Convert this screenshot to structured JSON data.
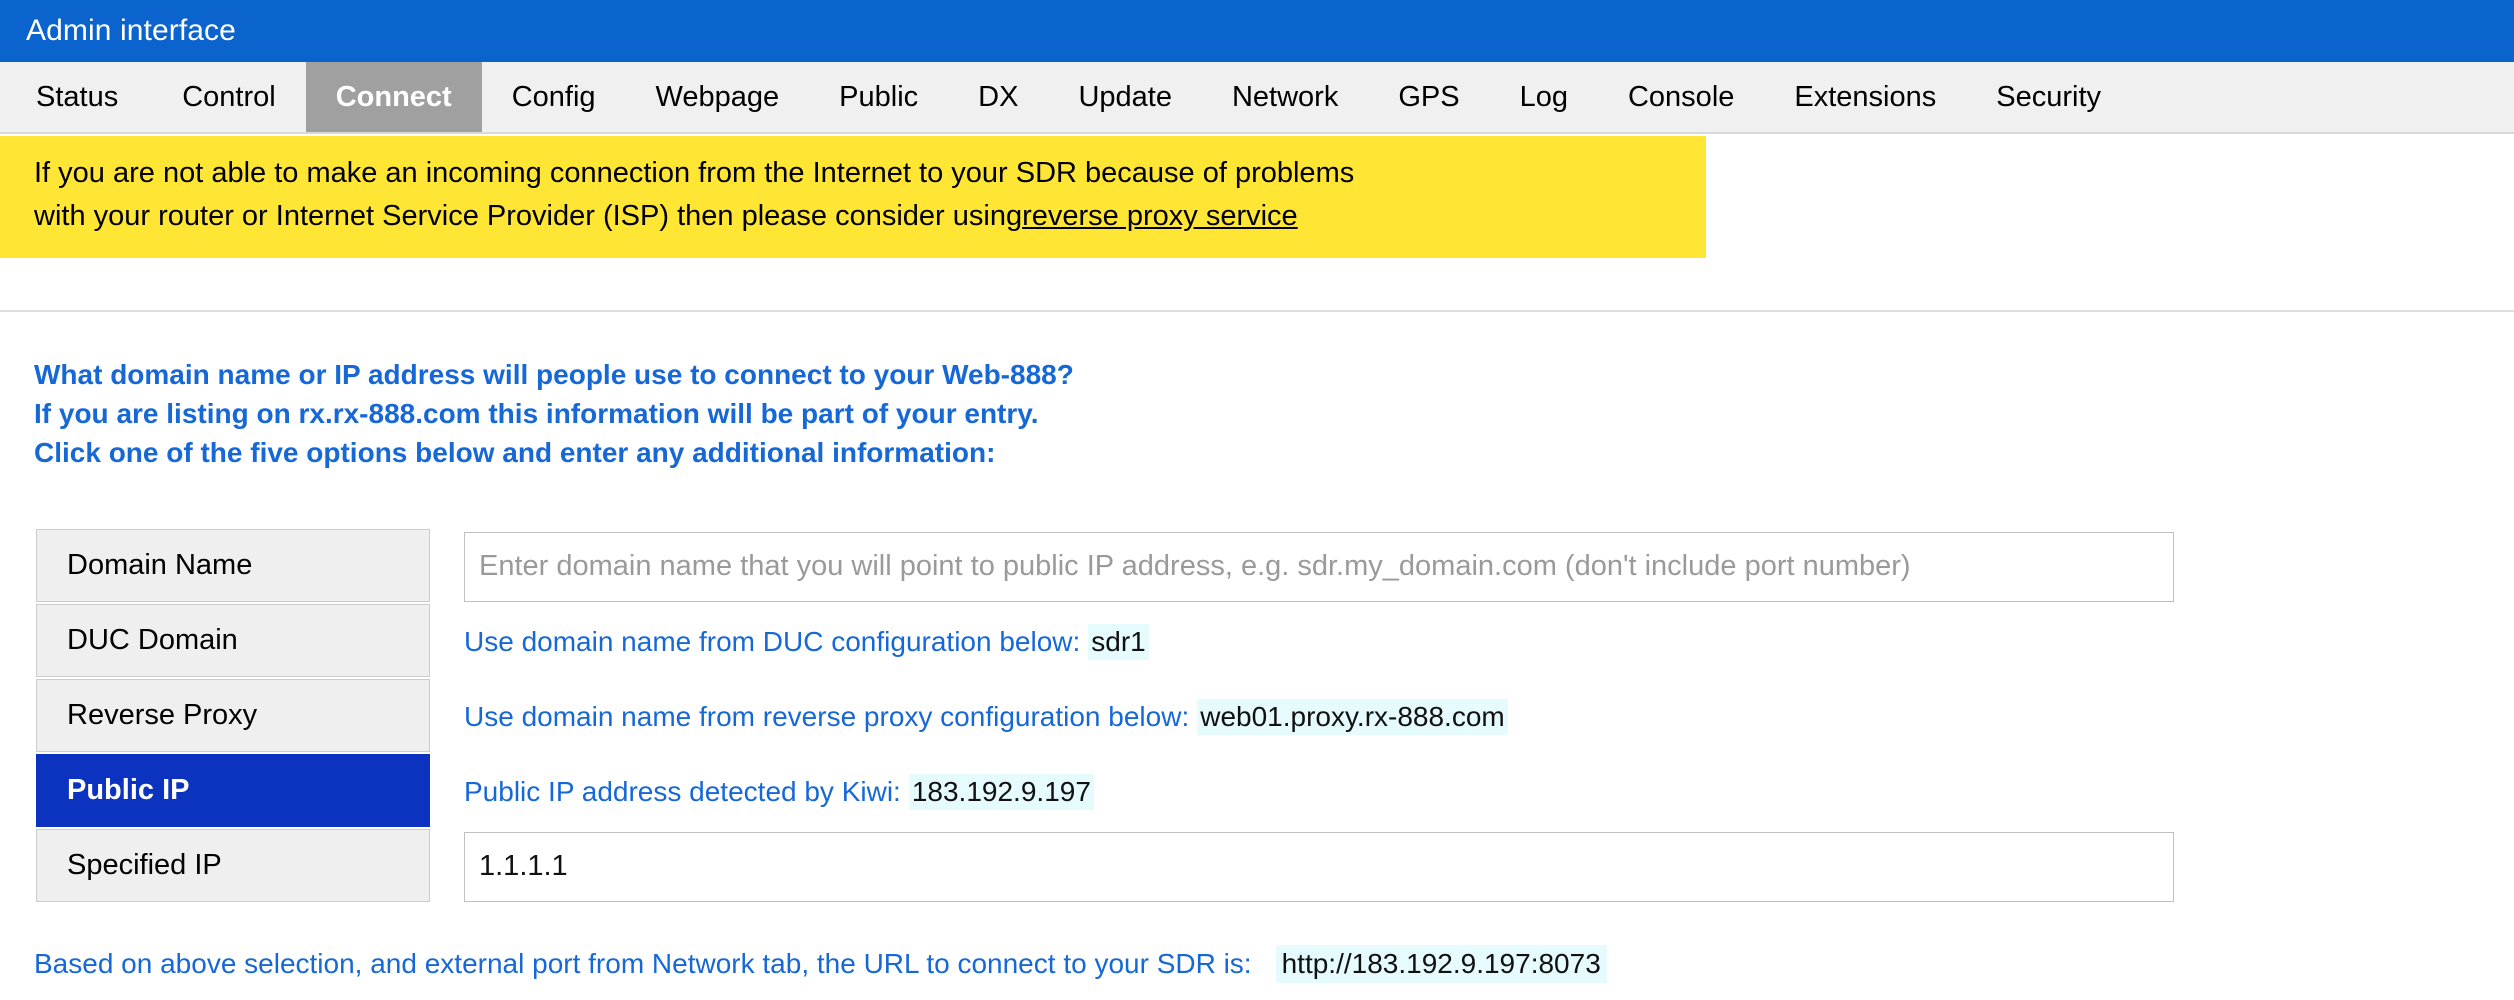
{
  "titlebar": {
    "title": "Admin interface",
    "background_color": "#0b63ce"
  },
  "tabs": {
    "active": "Connect",
    "active_background_color": "#a0a0a0",
    "items": [
      {
        "label": "Status"
      },
      {
        "label": "Control"
      },
      {
        "label": "Connect"
      },
      {
        "label": "Config"
      },
      {
        "label": "Webpage"
      },
      {
        "label": "Public"
      },
      {
        "label": "DX"
      },
      {
        "label": "Update"
      },
      {
        "label": "Network"
      },
      {
        "label": "GPS"
      },
      {
        "label": "Log"
      },
      {
        "label": "Console"
      },
      {
        "label": "Extensions"
      },
      {
        "label": "Security"
      }
    ]
  },
  "notice": {
    "background_color": "#ffe534",
    "line1": "If you are not able to make an incoming connection from the Internet to your SDR because of problems",
    "line2_prefix": "with your router or Internet Service Provider (ISP) then please consider using",
    "link_text": "reverse proxy service"
  },
  "headings": {
    "color": "#1668d6",
    "line1": "What domain name or IP address will people use to connect to your Web-888?",
    "line2": "If you are listing on rx.rx-888.com this information will be part of your entry.",
    "line3": "Click one of the five options below and enter any additional information:"
  },
  "chooser": {
    "selected_background_color": "#0b33bf",
    "items": [
      {
        "label": "Domain Name",
        "selected": false
      },
      {
        "label": "DUC Domain",
        "selected": false
      },
      {
        "label": "Reverse Proxy",
        "selected": false
      },
      {
        "label": "Public IP",
        "selected": true
      },
      {
        "label": "Specified IP",
        "selected": false
      }
    ]
  },
  "fields": {
    "domain_name": {
      "value": "",
      "placeholder": "Enter domain name that you will point to public IP address, e.g. sdr.my_domain.com (don't include port number)"
    },
    "duc_domain": {
      "label": "Use domain name from DUC configuration below:",
      "value": "sdr1"
    },
    "reverse_proxy": {
      "label": "Use domain name from reverse proxy configuration below:",
      "value": "web01.proxy.rx-888.com"
    },
    "public_ip": {
      "label": "Public IP address detected by Kiwi:",
      "value": "183.192.9.197"
    },
    "specified_ip": {
      "value": "1.1.1.1",
      "placeholder": ""
    }
  },
  "footer": {
    "url_label": "Based on above selection, and external port from Network tab, the URL to connect to your SDR is:",
    "url_value": "http://183.192.9.197:8073",
    "highlight_color": "#e6fbfd"
  }
}
